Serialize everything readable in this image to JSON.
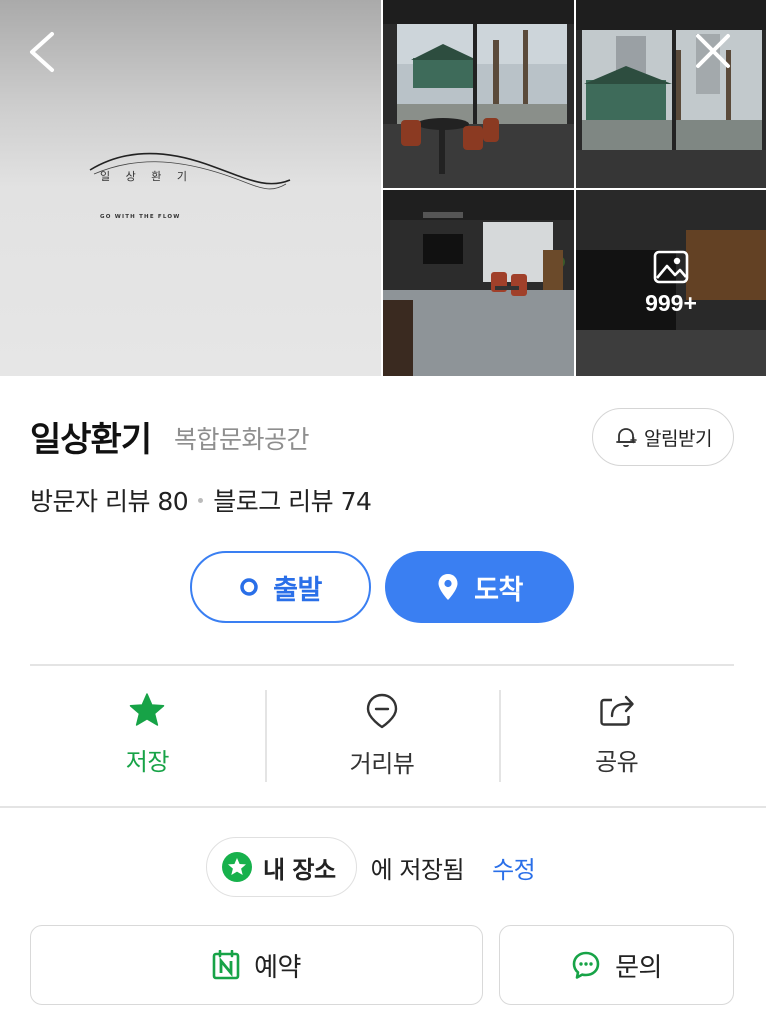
{
  "gallery": {
    "logo_text": "일 상 환 기",
    "logo_subtitle": "GO WITH THE FLOW",
    "more_count": "999+",
    "icons": {
      "back": "chevron-left-icon",
      "close": "close-icon",
      "more": "image-icon"
    }
  },
  "place": {
    "name": "일상환기",
    "category": "복합문화공간",
    "alert_label": "알림받기",
    "visitor_reviews": "방문자 리뷰 80",
    "blog_reviews": "블로그 리뷰 74"
  },
  "route": {
    "depart_label": "출발",
    "arrive_label": "도착"
  },
  "actions": [
    {
      "label": "저장",
      "icon": "star-icon"
    },
    {
      "label": "거리뷰",
      "icon": "pin-icon"
    },
    {
      "label": "공유",
      "icon": "share-icon"
    }
  ],
  "saved": {
    "chip_label": "내 장소",
    "status_text": "에 저장됨",
    "edit_label": "수정"
  },
  "bottom": {
    "reserve_label": "예약",
    "inquiry_label": "문의"
  },
  "colors": {
    "primary_blue": "#3a7ff2",
    "save_green": "#17a347",
    "naver_green": "#03c75a"
  }
}
